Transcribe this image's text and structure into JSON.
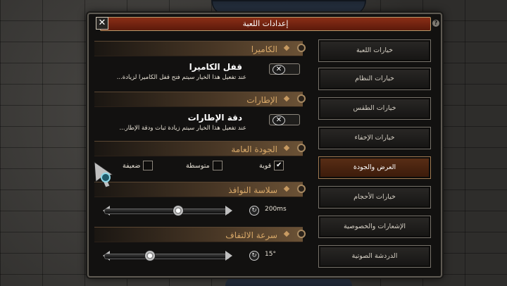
{
  "window": {
    "title": "إعدادات اللعبة",
    "close_glyph": "✕",
    "help_glyph": "?"
  },
  "sections": {
    "camera": {
      "header": "الكاميرا",
      "option_title": "قفل الكاميرا",
      "option_desc": "عند تفعيل هذا الخيار سيتم فتح قفل الكاميرا لزيادة...",
      "toggle_state": "off"
    },
    "frames": {
      "header": "الإطارات",
      "option_title": "دقة الإطارات",
      "option_desc": "عند تفعيل هذا الخيار سيتم زيادة ثبات ودقة الإطار...",
      "toggle_state": "off"
    },
    "quality": {
      "header": "الجودة العامة",
      "options": [
        {
          "label": "قوية",
          "checked": true
        },
        {
          "label": "متوسطة",
          "checked": false
        },
        {
          "label": "ضعيفة",
          "checked": false
        }
      ]
    },
    "smoothness": {
      "header": "سلاسة النوافذ",
      "value_text": "200ms",
      "fraction": 0.6
    },
    "rotation": {
      "header": "سرعة الالتفاف",
      "value_text": "15°",
      "fraction": 0.35
    }
  },
  "nav": {
    "items": [
      {
        "label": "خيارات اللعبة",
        "active": false
      },
      {
        "label": "خيارات النظام",
        "active": false
      },
      {
        "label": "خيارات الطقس",
        "active": false
      },
      {
        "label": "خيارات الإخفاء",
        "active": false
      },
      {
        "label": "العرض والجودة",
        "active": true
      },
      {
        "label": "خيارات الأحجام",
        "active": false
      },
      {
        "label": "الإشعارات والخصوصية",
        "active": false
      },
      {
        "label": "الدردشة الصوتية",
        "active": false
      }
    ]
  },
  "colors": {
    "accent": "#d8a868",
    "active_tab": "#5a2e16",
    "title_bar": "#8a2e16"
  },
  "icons": {
    "toggle_off": "✕",
    "check": "✔",
    "refresh": "↻"
  }
}
